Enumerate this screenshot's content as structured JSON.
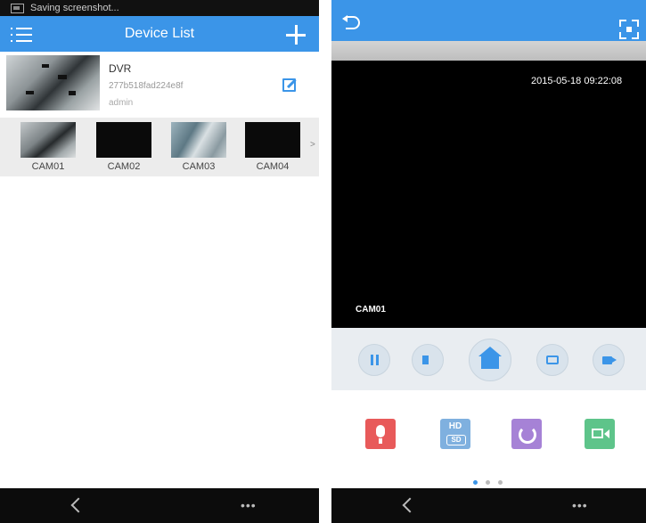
{
  "left": {
    "status_text": "Saving screenshot...",
    "title": "Device List",
    "device": {
      "name": "DVR",
      "id": "277b518fad224e8f",
      "user": "admin"
    },
    "cameras": [
      {
        "label": "CAM01",
        "preview": "scene"
      },
      {
        "label": "CAM02",
        "preview": "black"
      },
      {
        "label": "CAM03",
        "preview": "scene"
      },
      {
        "label": "CAM04",
        "preview": "black"
      }
    ],
    "strip_more": ">",
    "nav_more": "•••"
  },
  "right": {
    "timestamp": "2015-05-18 09:22:08",
    "cam_label": "CAM01",
    "hd_label": "HD",
    "sd_label": "SD",
    "nav_more": "•••",
    "page_dots": 3,
    "active_dot": 0
  },
  "colors": {
    "accent": "#3b95e8",
    "mic": "#e85a5a",
    "hd": "#7fb0df",
    "rotate": "#a682d6",
    "record": "#5ec48a"
  }
}
